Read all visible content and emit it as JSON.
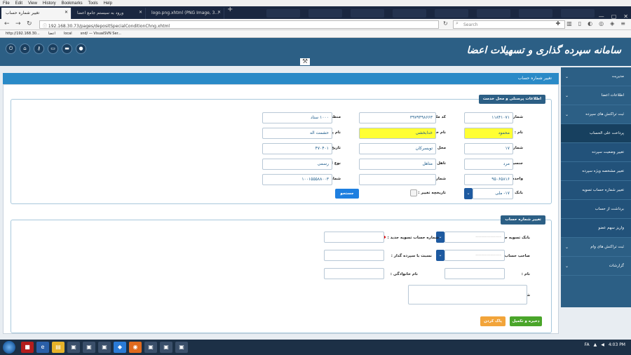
{
  "browser": {
    "menu": [
      "File",
      "Edit",
      "View",
      "History",
      "Bookmarks",
      "Tools",
      "Help"
    ],
    "tabs": [
      {
        "label": "تغییر شماره حساب",
        "active": true
      },
      {
        "label": "ورود به سیستم جامع اعضا",
        "active": false
      },
      {
        "label": "logo.png.xhtml (PNG Image, 3...",
        "active": false
      }
    ],
    "url": "192.168.30.73/pages/depositSpecialConditionChng.xhtml",
    "search_placeholder": "Search",
    "bookmarks": [
      "http://192.168.30...",
      "اعضا",
      "local",
      "snd/ — VisualSVN Ser..."
    ]
  },
  "app": {
    "title": "سامانه سپرده گذاری و تسهیلات اعضا",
    "header_icons": [
      "power-icon",
      "home-icon",
      "key-icon",
      "monitor-icon",
      "laptop-icon",
      "user-icon"
    ]
  },
  "sidebar": {
    "items": [
      {
        "label": "مدیریت",
        "expandable": true,
        "sub": false,
        "active": false
      },
      {
        "label": "اطلاعات اعضا",
        "expandable": true,
        "sub": false,
        "active": false
      },
      {
        "label": "ثبت تراکنش های سپرده",
        "expandable": true,
        "sub": false,
        "active": false
      },
      {
        "label": "پرداخت علی الحساب",
        "expandable": false,
        "sub": true,
        "active": true
      },
      {
        "label": "تغییر وضعیت سپرده",
        "expandable": false,
        "sub": true,
        "active": false
      },
      {
        "label": "تغییر مشخصه ویژه سپرده",
        "expandable": false,
        "sub": true,
        "active": false
      },
      {
        "label": "تغییر شماره حساب تسویه",
        "expandable": false,
        "sub": true,
        "active": false
      },
      {
        "label": "برداشت از حساب",
        "expandable": false,
        "sub": true,
        "active": false
      },
      {
        "label": "واریز سهم عضو",
        "expandable": false,
        "sub": true,
        "active": false
      },
      {
        "label": "ثبت تراکنش های وام",
        "expandable": true,
        "sub": false,
        "active": false
      },
      {
        "label": "گزارشات",
        "expandable": true,
        "sub": false,
        "active": false
      }
    ]
  },
  "page": {
    "title": "تغییر شماره حساب",
    "section1": {
      "title": "اطلاعات پرسنلی و محل خدمت",
      "labels": {
        "personnel_no": "شماره پرسنلی :",
        "national_code": "کد ملی :",
        "region": "منطقه :",
        "first_name": "نام :",
        "last_name": "نام خانوادگی :",
        "father_name": "نام پدر :",
        "id_no": "شماره شناسنامه :",
        "issue_place": "محل صدور :",
        "hire_date": "تاریخ تولد :",
        "gender": "جنسیت :",
        "marital": "تاهل :",
        "employment_type": "نوع استخدام :",
        "org_unit": "واحدسازمانی :",
        "prev_personnel": "شماره پرسنلی قبلی :",
        "settle_account": "شماره حساب تسویه :",
        "settle_bank": "بانک تسویه :",
        "change_history": "تاریخچه تغییر :"
      },
      "values": {
        "personnel_no": "۱۱۸۴۱۰۷۱",
        "national_code": "۳۹۷۹۴۹۸۶۶۳",
        "region": "۱۰۰۰ ستاد",
        "first_name": "محمود",
        "last_name": "خدابخشی",
        "father_name": "حشمت اله",
        "id_no": "۱۷",
        "issue_place": "تویسرکان",
        "hire_date": "۴۷۰۴۰۱",
        "gender": "مرد",
        "marital": "متاهل",
        "employment_type": "رسمی",
        "org_unit": "۹۵۰۶۵۸۱۶",
        "prev_personnel": "",
        "settle_account": "۱۰۰۱۵۵۵۸۸۰۰۳",
        "settle_bank": "۱۷- ملی"
      },
      "search_button": "جستجو"
    },
    "section2": {
      "title": "تغییر شماره حساب",
      "labels": {
        "new_bank": "بانک تسویه جدید :",
        "new_account": "شماره حساب تسویه جدید :",
        "account_owner": "صاحب حساب :",
        "relation": "نسبت با سپرده گذار :",
        "name": "نام :",
        "family": "نام خانوادگی :",
        "description": "شرح :"
      },
      "new_bank_placeholder": "-----------------",
      "owner_placeholder": "-----------------"
    },
    "buttons": {
      "save": "ذخیره و تکمیل",
      "clear": "پاک کردن"
    }
  },
  "taskbar": {
    "lang": "FA",
    "time": "4:03 PM"
  }
}
